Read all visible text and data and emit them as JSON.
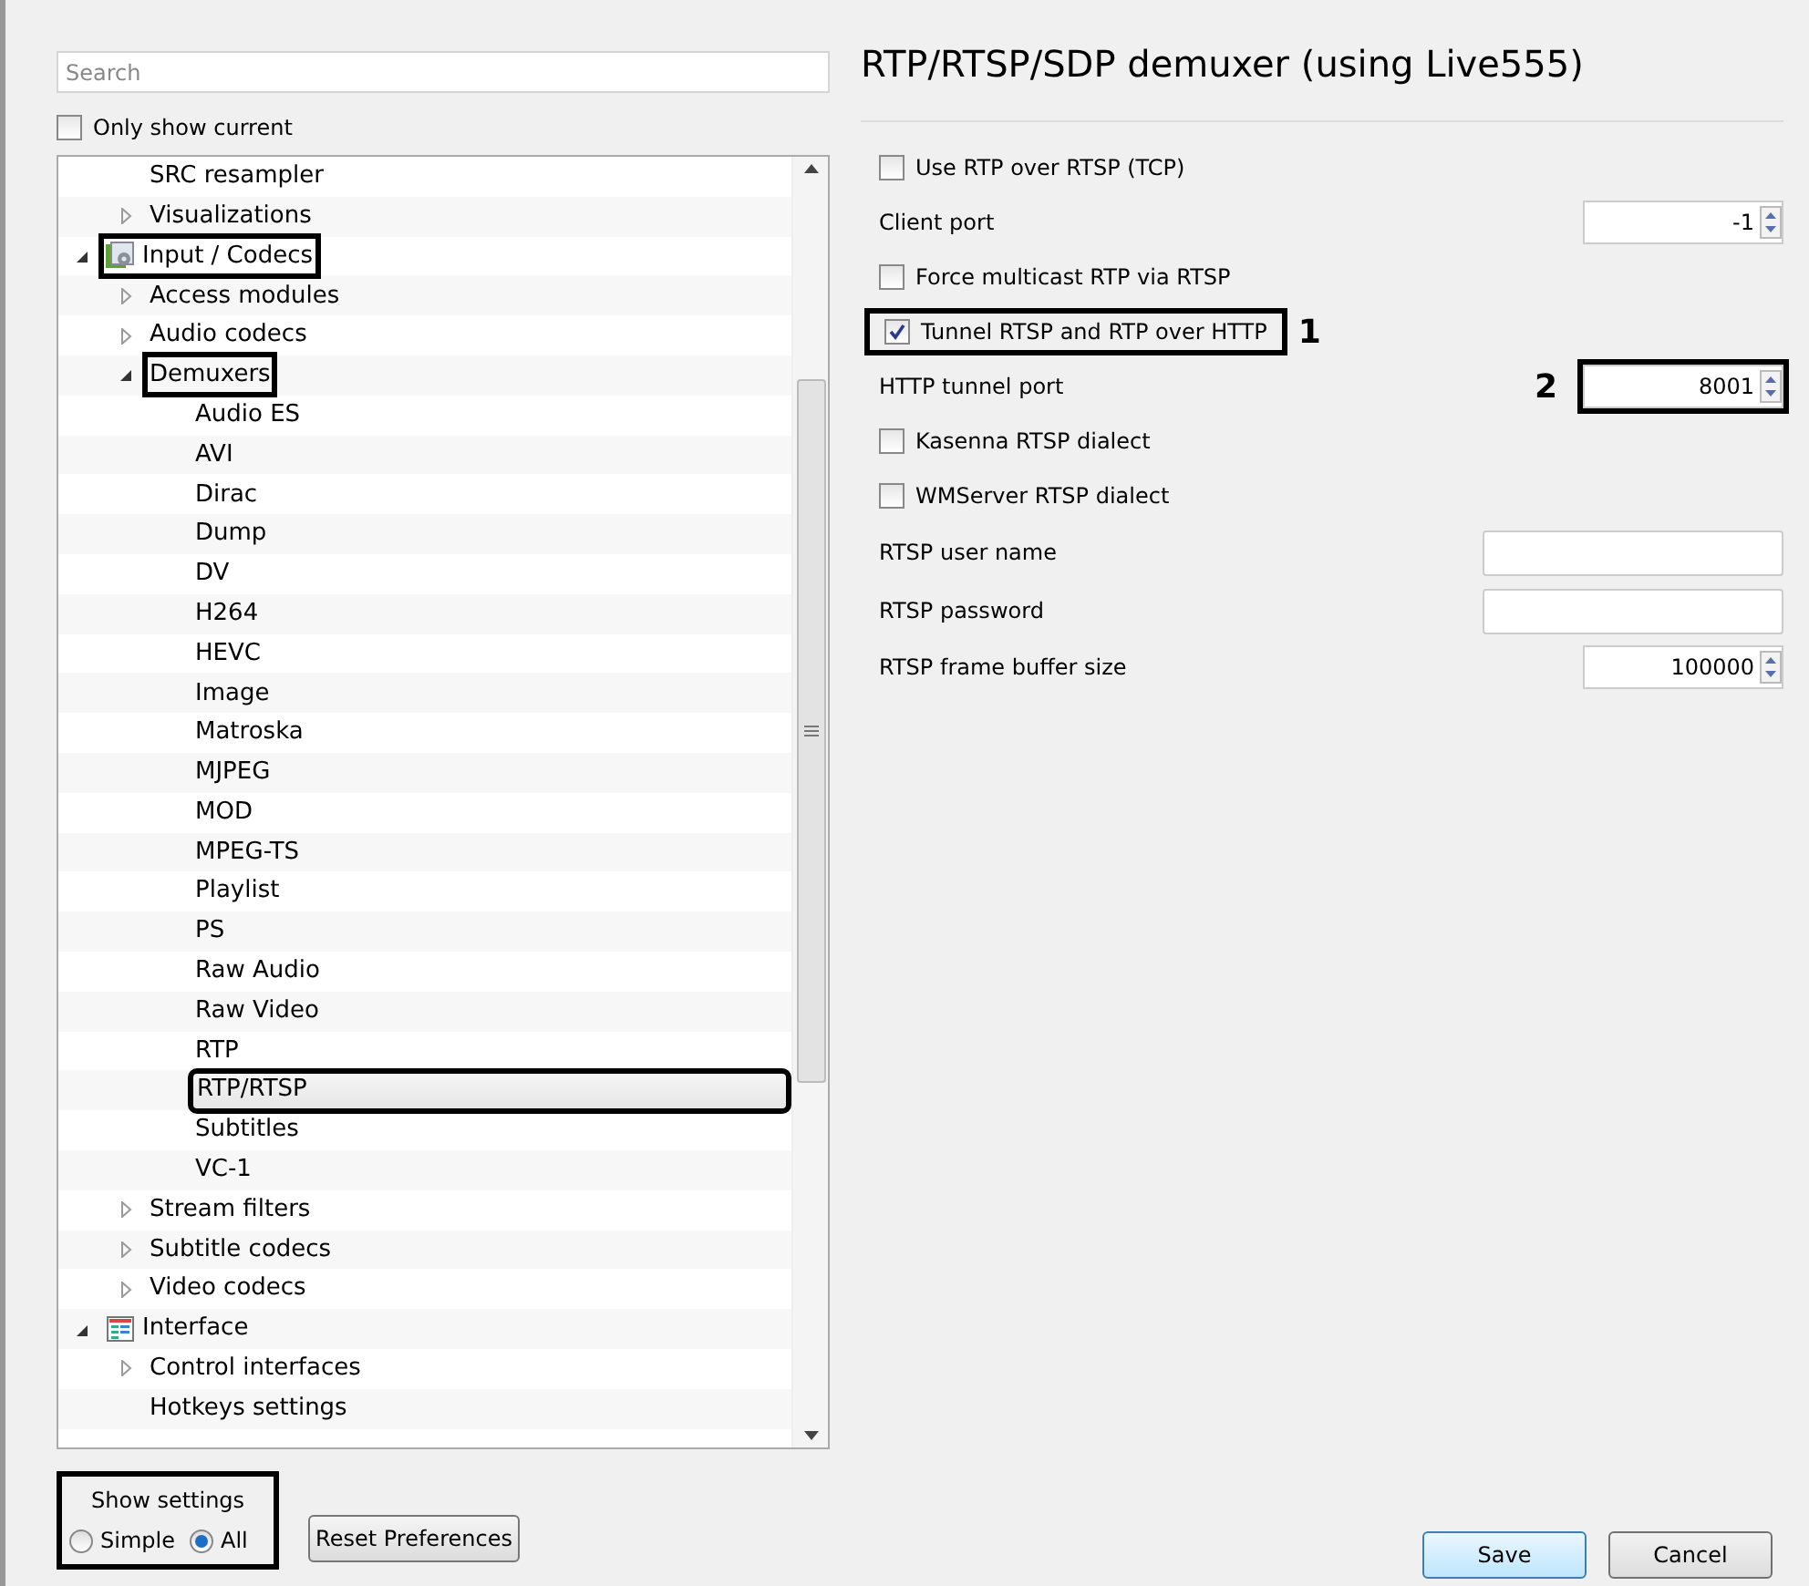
{
  "search": {
    "placeholder": "Search"
  },
  "only_show_current": {
    "label": "Only show current",
    "checked": false
  },
  "tree": {
    "items_above": [
      {
        "label": "SRC resampler",
        "selected": false,
        "highlighted": false
      },
      {
        "label": "Visualizations",
        "expanded": false,
        "selected": false,
        "highlighted": false
      }
    ],
    "items": [
      {
        "label": "Input / Codecs",
        "kind": "category",
        "expanded": true,
        "selected": false,
        "highlighted": true,
        "children": [
          {
            "label": "Access modules",
            "expanded": false,
            "selected": false,
            "highlighted": false
          },
          {
            "label": "Audio codecs",
            "expanded": false,
            "selected": false,
            "highlighted": false
          },
          {
            "label": "Demuxers",
            "expanded": true,
            "selected": false,
            "highlighted": true,
            "children": [
              {
                "label": "Audio ES",
                "selected": false,
                "highlighted": false
              },
              {
                "label": "AVI",
                "selected": false,
                "highlighted": false
              },
              {
                "label": "Dirac",
                "selected": false,
                "highlighted": false
              },
              {
                "label": "Dump",
                "selected": false,
                "highlighted": false
              },
              {
                "label": "DV",
                "selected": false,
                "highlighted": false
              },
              {
                "label": "H264",
                "selected": false,
                "highlighted": false
              },
              {
                "label": "HEVC",
                "selected": false,
                "highlighted": false
              },
              {
                "label": "Image",
                "selected": false,
                "highlighted": false
              },
              {
                "label": "Matroska",
                "selected": false,
                "highlighted": false
              },
              {
                "label": "MJPEG",
                "selected": false,
                "highlighted": false
              },
              {
                "label": "MOD",
                "selected": false,
                "highlighted": false
              },
              {
                "label": "MPEG-TS",
                "selected": false,
                "highlighted": false
              },
              {
                "label": "Playlist",
                "selected": false,
                "highlighted": false
              },
              {
                "label": "PS",
                "selected": false,
                "highlighted": false
              },
              {
                "label": "Raw Audio",
                "selected": false,
                "highlighted": false
              },
              {
                "label": "Raw Video",
                "selected": false,
                "highlighted": false
              },
              {
                "label": "RTP",
                "selected": false,
                "highlighted": false
              },
              {
                "label": "RTP/RTSP",
                "selected": true,
                "highlighted": true
              },
              {
                "label": "Subtitles",
                "selected": false,
                "highlighted": false
              },
              {
                "label": "VC-1",
                "selected": false,
                "highlighted": false
              }
            ]
          },
          {
            "label": "Stream filters",
            "expanded": false,
            "selected": false,
            "highlighted": false
          },
          {
            "label": "Subtitle codecs",
            "expanded": false,
            "selected": false,
            "highlighted": false
          },
          {
            "label": "Video codecs",
            "expanded": false,
            "selected": false,
            "highlighted": false
          }
        ]
      },
      {
        "label": "Interface",
        "kind": "category",
        "expanded": true,
        "selected": false,
        "highlighted": false,
        "children": [
          {
            "label": "Control interfaces",
            "expanded": false,
            "selected": false,
            "highlighted": false
          },
          {
            "label": "Hotkeys settings",
            "selected": false,
            "highlighted": false
          }
        ]
      }
    ]
  },
  "show_settings": {
    "title": "Show settings",
    "highlighted": true,
    "options": [
      {
        "label": "Simple",
        "selected": false
      },
      {
        "label": "All",
        "selected": true
      }
    ]
  },
  "reset_button": "Reset Preferences",
  "panel_title": "RTP/RTSP/SDP demuxer (using Live555)",
  "settings": [
    {
      "kind": "checkbox",
      "label": "Use RTP over RTSP (TCP)",
      "checked": false,
      "highlighted": false
    },
    {
      "kind": "spin",
      "label": "Client port",
      "value": "-1",
      "highlighted": false
    },
    {
      "kind": "checkbox",
      "label": "Force multicast RTP via RTSP",
      "checked": false,
      "highlighted": false
    },
    {
      "kind": "checkbox",
      "label": "Tunnel RTSP and RTP over HTTP",
      "checked": true,
      "highlighted": true,
      "callout": "1"
    },
    {
      "kind": "spin",
      "label": "HTTP tunnel port",
      "value": "8001",
      "highlighted": true,
      "callout": "2"
    },
    {
      "kind": "checkbox",
      "label": "Kasenna RTSP dialect",
      "checked": false,
      "highlighted": false
    },
    {
      "kind": "checkbox",
      "label": "WMServer RTSP dialect",
      "checked": false,
      "highlighted": false
    },
    {
      "kind": "text",
      "label": "RTSP user name",
      "highlighted": false
    },
    {
      "kind": "text",
      "label": "RTSP password",
      "highlighted": false
    },
    {
      "kind": "spin",
      "label": "RTSP frame buffer size",
      "value": "100000",
      "highlighted": false
    }
  ],
  "buttons": [
    {
      "label": "Save",
      "kind": "default"
    },
    {
      "label": "Cancel",
      "kind": "normal"
    }
  ]
}
